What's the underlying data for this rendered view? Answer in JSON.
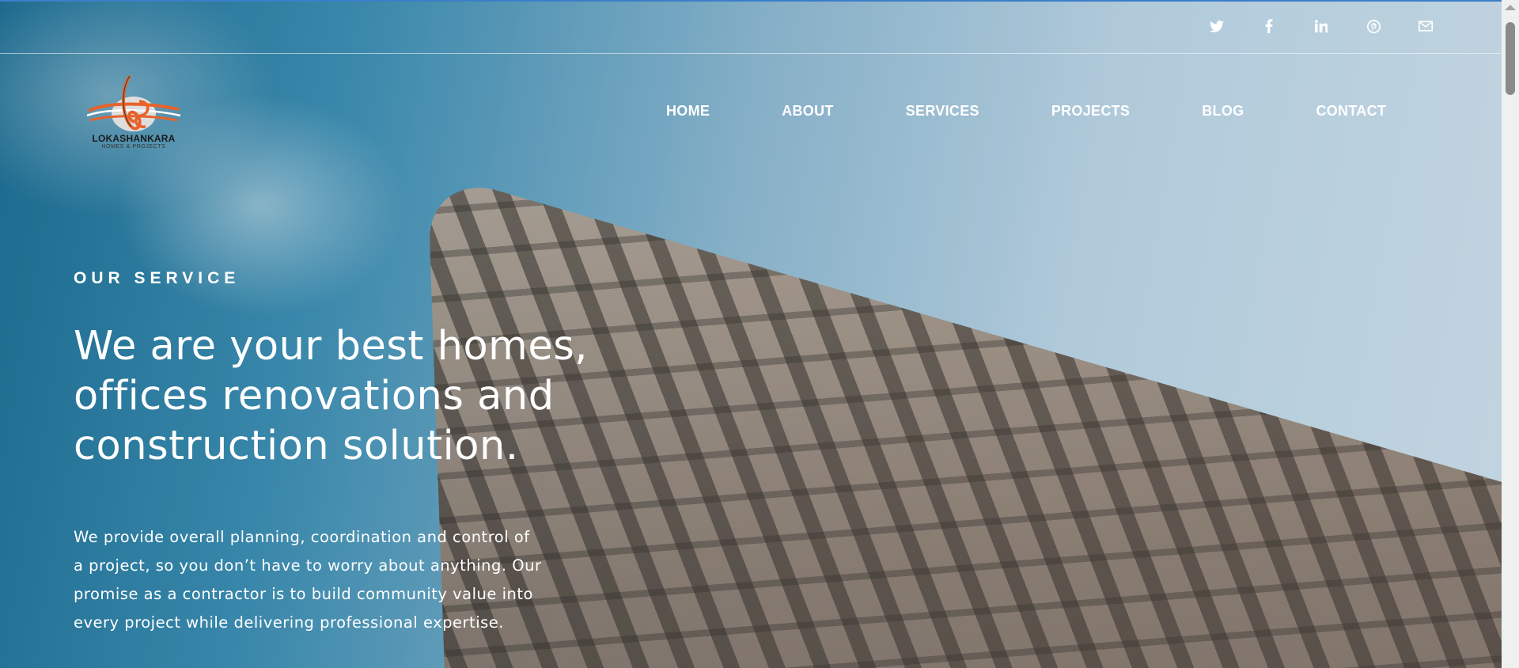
{
  "brand": {
    "name": "LOKASHANKARA",
    "tagline": "HOMES & PROJECTS",
    "colors": {
      "accent": "#e8622a",
      "nav_text": "#ffffff"
    }
  },
  "social": [
    {
      "name": "twitter-icon",
      "glyph": "🐦"
    },
    {
      "name": "facebook-icon",
      "glyph": "f"
    },
    {
      "name": "linkedin-icon",
      "glyph": "in"
    },
    {
      "name": "pinterest-icon",
      "glyph": "P"
    },
    {
      "name": "email-icon",
      "glyph": "✉"
    }
  ],
  "nav": {
    "items": [
      "HOME",
      "ABOUT",
      "SERVICES",
      "PROJECTS",
      "BLOG",
      "CONTACT"
    ]
  },
  "hero": {
    "eyebrow": "OUR SERVICE",
    "title_line1": "We are your best homes,",
    "title_line2": "offices renovations and",
    "title_line3": "construction solution.",
    "description_line1": "We provide overall planning, coordination and control of",
    "description_line2": "a project, so you don’t have to worry about anything. Our",
    "description_line3": "promise as a contractor is to build community value into",
    "description_line4": "every project while delivering professional expertise."
  }
}
